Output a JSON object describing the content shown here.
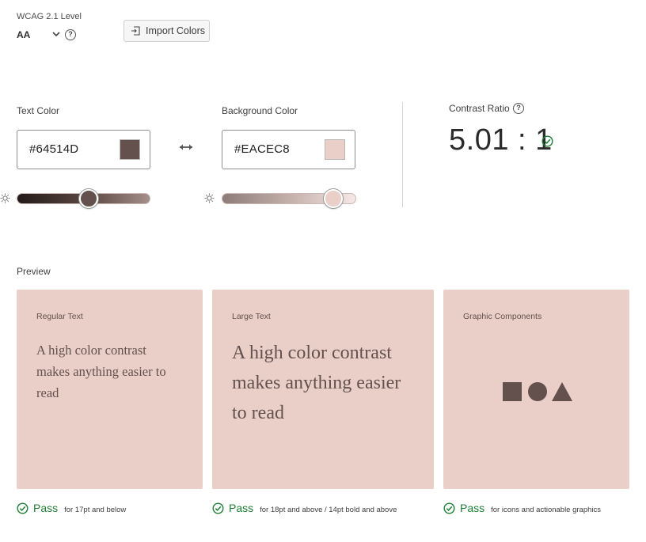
{
  "wcag": {
    "label": "WCAG 2.1 Level",
    "value": "AA",
    "help": "?"
  },
  "import_button": {
    "label": "Import Colors"
  },
  "text_color": {
    "label": "Text Color",
    "hex": "#64514D",
    "lightness": 0.54
  },
  "background_color": {
    "label": "Background Color",
    "hex": "#EACEC8",
    "lightness": 0.83
  },
  "contrast": {
    "label": "Contrast Ratio",
    "help": "?",
    "value": "5.01 : 1",
    "status_color": "#1e7d34"
  },
  "preview": {
    "label": "Preview",
    "background": "#EACEC8",
    "foreground": "#64514D",
    "cards": [
      {
        "title": "Regular Text",
        "sample": "A high color contrast makes anything easier to read",
        "result": "Pass",
        "note": "for 17pt and below"
      },
      {
        "title": "Large Text",
        "sample": "A high color contrast makes anything easier to read",
        "result": "Pass",
        "note": "for 18pt and above / 14pt bold and above"
      },
      {
        "title": "Graphic Components",
        "shapes": [
          "square-icon",
          "circle-icon",
          "triangle-icon"
        ],
        "result": "Pass",
        "note": "for icons and actionable graphics"
      }
    ]
  },
  "icons": {
    "import": "import-icon",
    "swap": "swap-arrows-icon",
    "brightness": "sun-icon",
    "chevron": "chevron-down-icon",
    "check": "checkmark-circle-icon"
  }
}
